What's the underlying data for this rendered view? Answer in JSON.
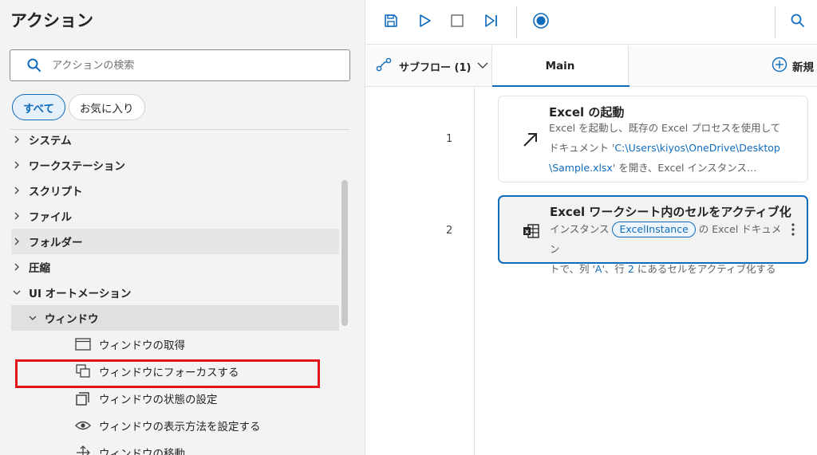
{
  "actions_panel": {
    "title": "アクション",
    "search_placeholder": "アクションの検索",
    "filters": [
      {
        "label": "すべて",
        "active": true
      },
      {
        "label": "お気に入り",
        "active": false
      }
    ],
    "tree": [
      {
        "label": "システム",
        "expanded": false,
        "level": 0
      },
      {
        "label": "ワークステーション",
        "expanded": false,
        "level": 0
      },
      {
        "label": "スクリプト",
        "expanded": false,
        "level": 0
      },
      {
        "label": "ファイル",
        "expanded": false,
        "level": 0
      },
      {
        "label": "フォルダー",
        "expanded": false,
        "level": 0
      },
      {
        "label": "圧縮",
        "expanded": false,
        "level": 0
      },
      {
        "label": "UI オートメーション",
        "expanded": true,
        "level": 0
      },
      {
        "label": "ウィンドウ",
        "expanded": true,
        "level": 1
      }
    ],
    "leaves": [
      {
        "label": "ウィンドウの取得",
        "icon": "window-icon"
      },
      {
        "label": "ウィンドウにフォーカスする",
        "icon": "window-focus-icon"
      },
      {
        "label": "ウィンドウの状態の設定",
        "icon": "window-state-icon"
      },
      {
        "label": "ウィンドウの表示方法を設定する",
        "icon": "eye-icon"
      },
      {
        "label": "ウィンドウの移動",
        "icon": "move-icon"
      }
    ]
  },
  "toolbar": {
    "buttons": [
      "save-icon",
      "run-icon",
      "stop-icon",
      "step-icon",
      "record-icon",
      "search-icon"
    ]
  },
  "tabs": {
    "subflow_label": "サブフロー (1)",
    "main_label": "Main",
    "new_label": "新規"
  },
  "flow": {
    "steps": [
      {
        "line": "1",
        "title": "Excel の起動",
        "desc_line1": "Excel を起動し、既存の Excel プロセスを使用して",
        "desc_line2_prefix": "ドキュメント '",
        "desc_path1": "C:\\Users\\kiyos\\OneDrive\\Desktop",
        "desc_path2": "\\Sample.xlsx",
        "desc_line3_suffix": "' を開き、Excel インスタンス…"
      },
      {
        "line": "2",
        "title": "Excel ワークシート内のセルをアクティブ化",
        "desc_prefix": "インスタンス ",
        "desc_var": "ExcelInstance",
        "desc_after_var": " の Excel ドキュメン",
        "desc_line2_prefix": "トで、列 '",
        "desc_col": "A",
        "desc_mid": "'、行 ",
        "desc_row": "2",
        "desc_suffix": " にあるセルをアクティブ化する"
      }
    ]
  },
  "colors": {
    "accent": "#0f6cbd",
    "highlight_box": "#e4141b"
  }
}
